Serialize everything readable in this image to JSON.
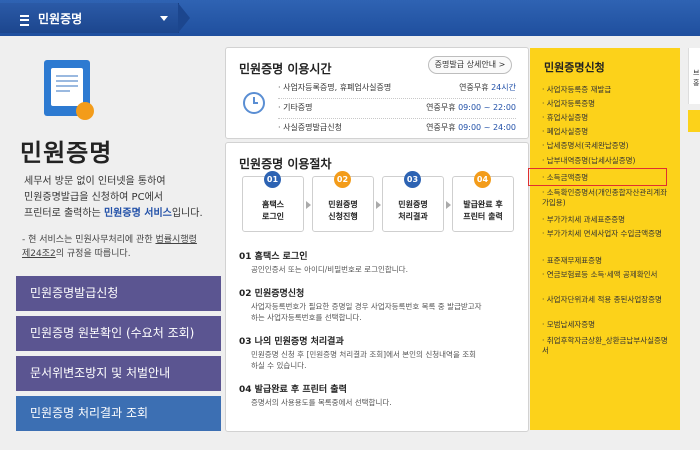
{
  "topbar": {
    "menu_label": "민원증명"
  },
  "left": {
    "title": "민원증명",
    "desc_1": "세무서 방문 없이 인터넷을 통하여",
    "desc_2": "민원증명발급을 신청하여 PC에서",
    "desc_3_pre": "프린터로 출력하는 ",
    "desc_3_hl": "민원증명 서비스",
    "desc_3_post": "입니다.",
    "note_pre": "- 현 서비스는 민원사무처리에 관한 ",
    "note_u": "법률시행령",
    "note_2": "제24조2",
    "note_post": "의 규정을 따릅니다.",
    "buttons": [
      "민원증명발급신청",
      "민원증명 원본확인 (수요처 조회)",
      "문서위변조방지 및 처벌안내",
      "민원증명 처리결과 조회"
    ]
  },
  "hours": {
    "title": "민원증명 이용시간",
    "detail_button": "증명발급 상세안내 >",
    "rows": [
      {
        "name": "· 사업자등록증명, 휴폐업사실증명",
        "time_pre": "연중무휴 ",
        "time_hl": "24시간"
      },
      {
        "name": "· 기타증명",
        "time_pre": "연중무휴 ",
        "time_hl": "09:00 ~ 22:00"
      },
      {
        "name": "· 사실증명발급신청",
        "time_pre": "연중무휴 ",
        "time_hl": "09:00 ~ 24:00"
      }
    ]
  },
  "process": {
    "title": "민원증명 이용절차",
    "steps": [
      {
        "num": "01",
        "l1": "홈택스",
        "l2": "로그인",
        "color": "#2d63b3"
      },
      {
        "num": "02",
        "l1": "민원증명",
        "l2": "신청진행",
        "color": "#f39c1a"
      },
      {
        "num": "03",
        "l1": "민원증명",
        "l2": "처리결과",
        "color": "#2d63b3"
      },
      {
        "num": "04",
        "l1": "발급완료 후",
        "l2": "프린터 출력",
        "color": "#f39c1a"
      }
    ],
    "details": [
      {
        "head": "01 홈택스 로그인",
        "body": [
          "공인인증서 또는 아이디/비밀번호로 로그인합니다."
        ]
      },
      {
        "head": "02 민원증명신청",
        "body": [
          "사업자등록번호가 필요한 증명일 경우 사업자등록번호 목록 중 발급받고자",
          "하는 사업자등록번호를 선택합니다."
        ]
      },
      {
        "head": "03 나의 민원증명 처리결과",
        "body": [
          "민원증명 신청 후 [민원증명 처리결과 조회]에서 본인의 신청내역을 조회",
          "하실 수 있습니다."
        ]
      },
      {
        "head": "04 발급완료 후 프린터 출력",
        "body": [
          "증명서의 사용용도를 목록중에서 선택합니다."
        ]
      }
    ]
  },
  "apply": {
    "title": "민원증명신청",
    "items": [
      "사업자등록증 재발급",
      "사업자등록증명",
      "휴업사실증명",
      "폐업사실증명",
      "납세증명서(국세완납증명)",
      "납부내역증명(납세사실증명)",
      "소득금액증명",
      "소득확인증명서(개인종합자산관리계좌 가입용)",
      "부가가치세 과세표준증명",
      "부가가치세 면세사업자 수입금액증명",
      "표준재무제표증명",
      "연금보험료등 소득·세액 공제확인서",
      "사업자단위과세 적용 종된사업장증명",
      "모범납세자증명",
      "취업후학자금상환_상환금납부사실증명서"
    ],
    "highlighted_index": 6
  },
  "edge": {
    "fragment": "브 홍"
  }
}
